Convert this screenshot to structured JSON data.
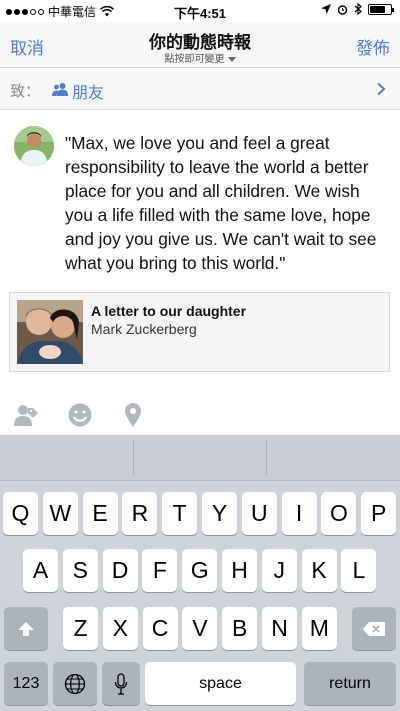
{
  "status_bar": {
    "carrier": "中華電信",
    "time": "下午4:51",
    "battery_level": 0.75
  },
  "nav": {
    "cancel_label": "取消",
    "title": "你的動態時報",
    "subtitle": "點按即可變更",
    "post_label": "發佈"
  },
  "audience": {
    "to_label": "致：",
    "value": "朋友"
  },
  "post": {
    "text": "\"Max, we love you and feel a great responsibility to leave the world a better place for you and all children. We wish you a life filled with the same love, hope and joy you give us. We can't wait to see what you bring to this world.\""
  },
  "link_card": {
    "title": "A letter to our daughter",
    "subtitle": "Mark Zuckerberg"
  },
  "keyboard": {
    "row1": [
      "Q",
      "W",
      "E",
      "R",
      "T",
      "Y",
      "U",
      "I",
      "O",
      "P"
    ],
    "row2": [
      "A",
      "S",
      "D",
      "F",
      "G",
      "H",
      "J",
      "K",
      "L"
    ],
    "row3": [
      "Z",
      "X",
      "C",
      "V",
      "B",
      "N",
      "M"
    ],
    "numbers_label": "123",
    "space_label": "space",
    "return_label": "return"
  },
  "colors": {
    "accent": "#4f7fc9",
    "keyboard_bg": "#cfd3d9"
  }
}
